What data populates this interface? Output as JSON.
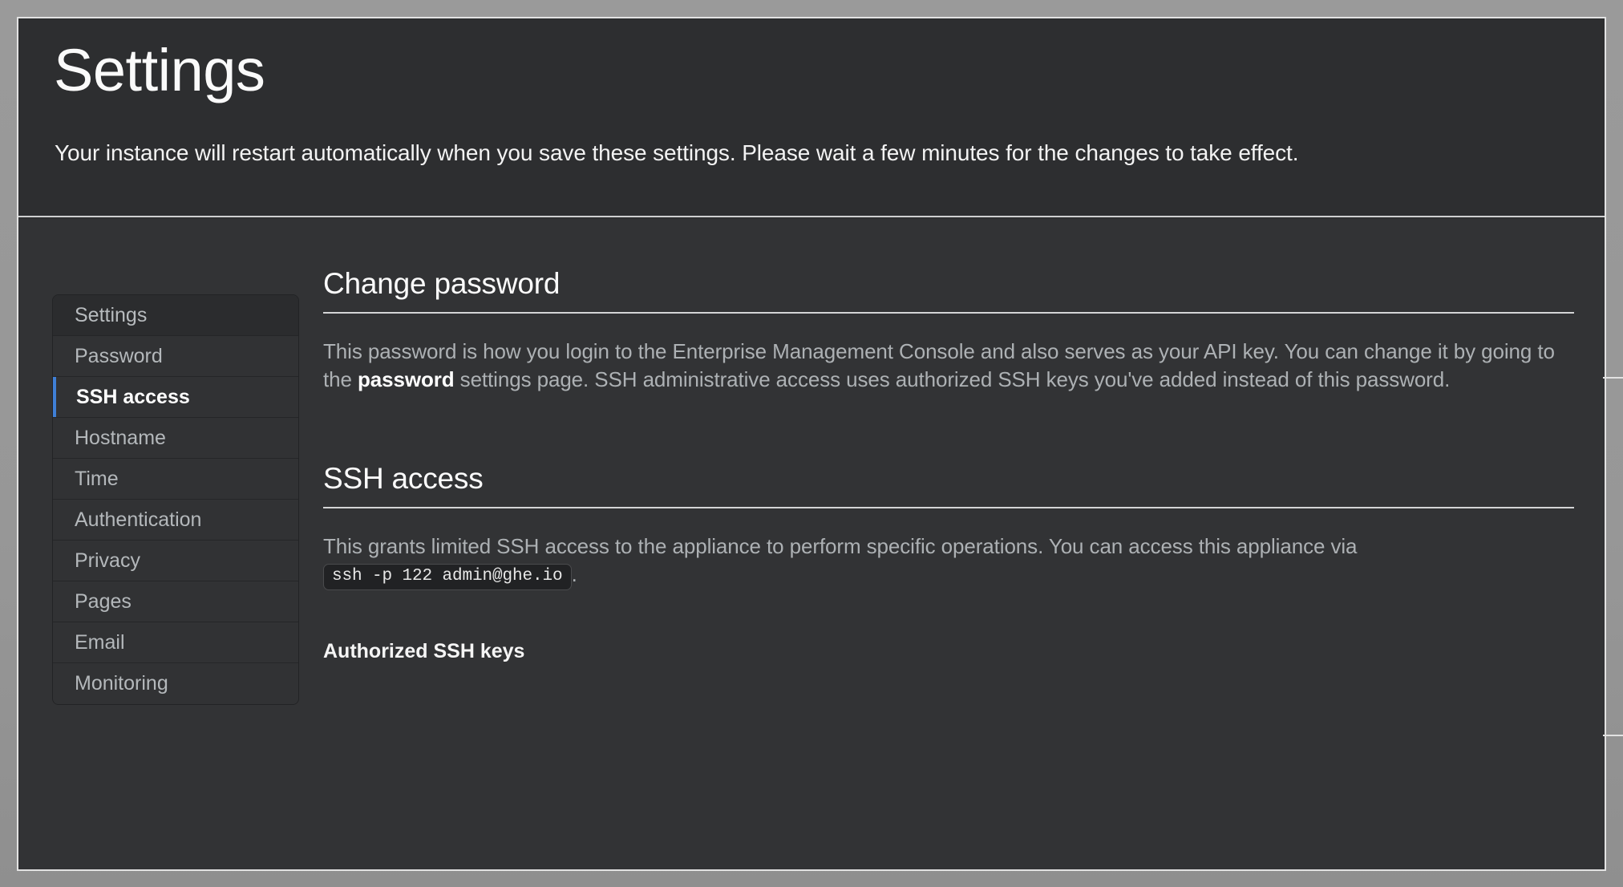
{
  "header": {
    "title": "Settings",
    "subtitle": "Your instance will restart automatically when you save these settings. Please wait a few minutes for the changes to take effect."
  },
  "sidebar": {
    "items": [
      {
        "label": "Settings",
        "state": "header"
      },
      {
        "label": "Password",
        "state": "default"
      },
      {
        "label": "SSH access",
        "state": "active"
      },
      {
        "label": "Hostname",
        "state": "default"
      },
      {
        "label": "Time",
        "state": "default"
      },
      {
        "label": "Authentication",
        "state": "default"
      },
      {
        "label": "Privacy",
        "state": "default"
      },
      {
        "label": "Pages",
        "state": "default"
      },
      {
        "label": "Email",
        "state": "default"
      },
      {
        "label": "Monitoring",
        "state": "default"
      }
    ]
  },
  "main": {
    "change_password": {
      "title": "Change password",
      "body_part1": "This password is how you login to the Enterprise Management Console and also serves as your API key. You can change it by going to the ",
      "link_text": "password",
      "body_part2": " settings page. SSH administrative access uses authorized SSH keys you've added instead of this password."
    },
    "ssh_access": {
      "title": "SSH access",
      "body_part1": "This grants limited SSH access to the appliance to perform specific operations. You can access this appliance via ",
      "code": "ssh -p 122 admin@ghe.io",
      "body_part2": ".",
      "subsection_title": "Authorized SSH keys"
    }
  },
  "colors": {
    "page_background": "#2f3032",
    "header_background": "#2d2e30",
    "body_background": "#323335",
    "sidebar_background": "#313234",
    "accent_blue": "#3f7fd6",
    "text_primary": "#fcfcfc",
    "text_muted": "#adb1b4",
    "desktop_background": "#9a9a9a",
    "frame_border": "#e2e2e2"
  }
}
